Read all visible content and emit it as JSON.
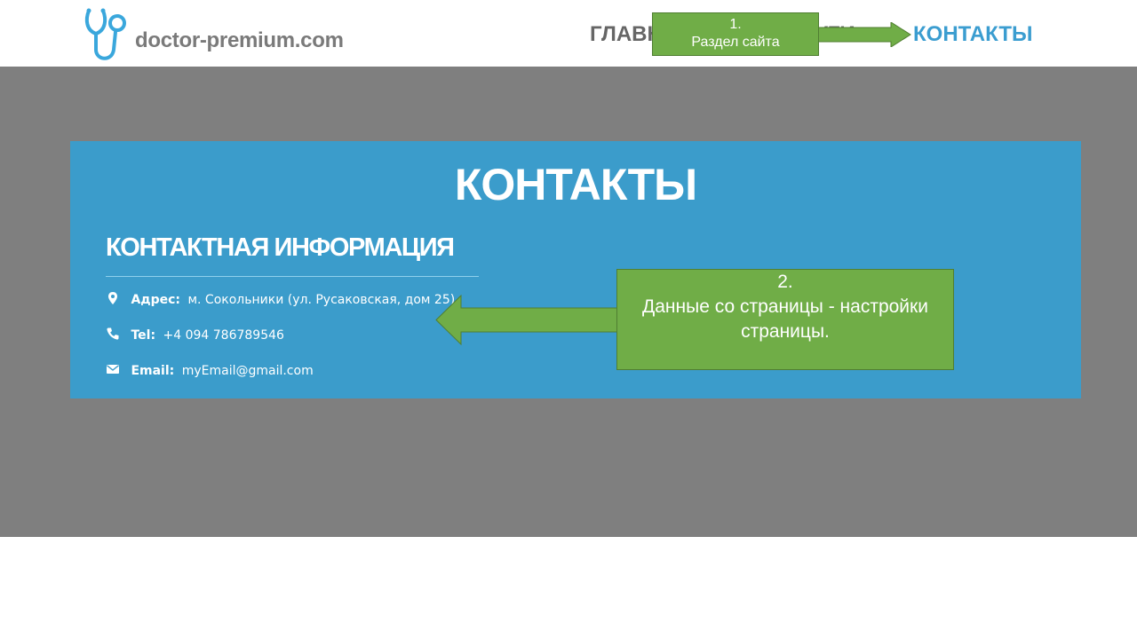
{
  "header": {
    "logo_text": "doctor-premium.com",
    "nav": {
      "home": "ГЛАВН",
      "services": "ЛУГИ",
      "contacts": "КОНТАКТЫ"
    }
  },
  "callouts": {
    "site_section": {
      "number": "1.",
      "text": "Раздел сайта"
    },
    "page_data": {
      "number": "2.",
      "text": "Данные со страницы - настройки страницы."
    }
  },
  "contacts": {
    "title": "КОНТАКТЫ",
    "heading": "КОНТАКТНАЯ ИНФОРМАЦИЯ",
    "address": {
      "label": "Адрес:",
      "value": "м. Сокольники (ул. Русаковская, дом 25)",
      "icon": "map-marker-icon"
    },
    "tel": {
      "label": "Tel:",
      "value": "+4 094 786789546",
      "icon": "phone-icon"
    },
    "email": {
      "label": "Email:",
      "value": "myEmail@gmail.com",
      "icon": "envelope-icon"
    }
  },
  "colors": {
    "panel": "#3b9ccb",
    "backdrop": "#7f7f7f",
    "callout": "#70ad47",
    "nav_active": "#3b9dd0",
    "logo": "#3aa7dc"
  }
}
